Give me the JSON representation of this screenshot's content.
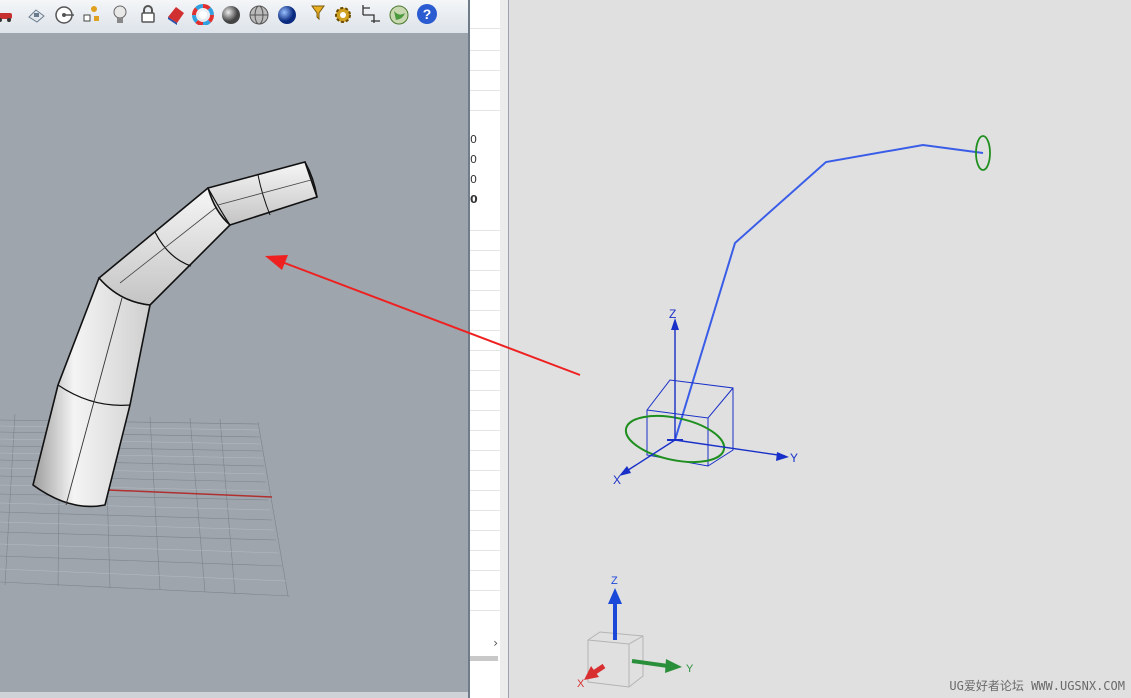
{
  "toolbar": {
    "icons": [
      {
        "name": "car-render-icon",
        "color": "#c83030"
      },
      {
        "name": "options-icon",
        "color": "#6a7d90"
      },
      {
        "name": "target-icon",
        "color": "#555555"
      },
      {
        "name": "snap-points-icon",
        "color": "#e0a020"
      },
      {
        "name": "light-bulb-icon",
        "color": "#d8d8d8"
      },
      {
        "name": "lock-icon",
        "color": "#555555"
      },
      {
        "name": "material-icon",
        "color": "#d03030"
      },
      {
        "name": "color-wheel-icon",
        "color": "#30a0e0"
      },
      {
        "name": "shaded-sphere-icon",
        "color": "#707070"
      },
      {
        "name": "wireframe-sphere-icon",
        "color": "#8a8a8a"
      },
      {
        "name": "blue-sphere-icon",
        "color": "#1a4fb0"
      },
      {
        "name": "filter-icon",
        "color": "#e8b020"
      },
      {
        "name": "settings-gear-icon",
        "color": "#d0a020"
      },
      {
        "name": "dimension-icon",
        "color": "#333333"
      },
      {
        "name": "environment-globe-icon",
        "color": "#4a9a40"
      },
      {
        "name": "help-icon",
        "color": "#2a5bd0"
      }
    ]
  },
  "side_panel": {
    "values": [
      "0",
      "0",
      "0",
      "0"
    ],
    "scroll_right_glyph": "›"
  },
  "right_view": {
    "triad_main": {
      "x_label": "X",
      "y_label": "Y",
      "z_label": "Z"
    },
    "triad_corner": {
      "x_label": "X",
      "y_label": "Y",
      "z_label": "Z"
    },
    "colors": {
      "path": "#3a5de8",
      "section": "#1f8f1f",
      "triad_axis": "#1930c8",
      "arrow_x": "#d83030",
      "arrow_y": "#2a8f3a",
      "arrow_z": "#1a48d8"
    }
  },
  "watermark": "UG爱好者论坛 WWW.UGSNX.COM"
}
